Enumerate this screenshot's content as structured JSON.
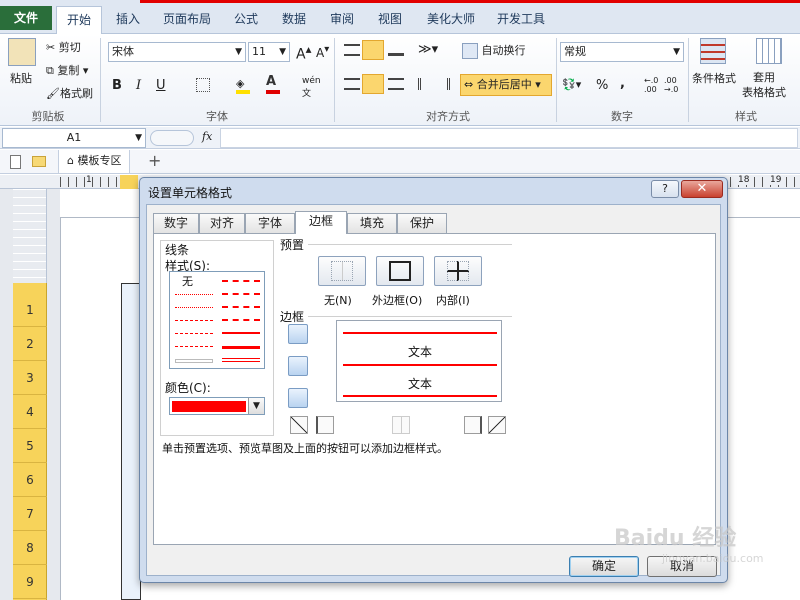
{
  "ribbon_tabs": [
    "文件",
    "开始",
    "插入",
    "页面布局",
    "公式",
    "数据",
    "审阅",
    "视图",
    "美化大师",
    "开发工具"
  ],
  "clipboard": {
    "paste": "粘贴",
    "cut": "剪切",
    "copy": "复制",
    "format_painter": "格式刷",
    "group": "剪贴板"
  },
  "font": {
    "name": "宋体",
    "size": "11",
    "bold": "B",
    "italic": "I",
    "underline": "U",
    "group": "字体",
    "font_color": "#e00000",
    "fill_color": "#ffe000",
    "phonetic": "wén"
  },
  "alignment": {
    "wrap": "自动换行",
    "merge": "合并后居中",
    "group": "对齐方式"
  },
  "number": {
    "format": "常规",
    "percent": "%",
    "comma": ",",
    "inc_decimal": "←.0\n.00",
    "dec_decimal": ".00\n→.0",
    "group": "数字"
  },
  "styles": {
    "conditional": "条件格式",
    "table": "套用\n表格格式",
    "group": "样式"
  },
  "formula_bar": {
    "name_box": "A1",
    "fx": "fx"
  },
  "doc_tabs": {
    "template": "模板专区",
    "add": "+"
  },
  "row_numbers": [
    "1",
    "2",
    "3",
    "4",
    "5",
    "6",
    "7",
    "8",
    "9"
  ],
  "ruler_numbers": {
    "left": "1",
    "right1": "18",
    "right2": "19"
  },
  "dialog": {
    "title": "设置单元格格式",
    "help": "?",
    "close": "✕",
    "tabs": [
      "数字",
      "对齐",
      "字体",
      "边框",
      "填充",
      "保护"
    ],
    "active_tab": "边框",
    "line_label": "线条",
    "style_label": "样式(S):",
    "none_style": "无",
    "color_label": "颜色(C):",
    "line_color": "#ff0000",
    "presets_label": "预置",
    "presets": [
      "无(N)",
      "外边框(O)",
      "内部(I)"
    ],
    "border_label": "边框",
    "preview_text": [
      "文本",
      "文本"
    ],
    "hint": "单击预置选项、预览草图及上面的按钮可以添加边框样式。",
    "ok": "确定",
    "cancel": "取消"
  },
  "watermark": {
    "main": "Baidu 经验",
    "sub": "jingyan.baidu.com"
  }
}
